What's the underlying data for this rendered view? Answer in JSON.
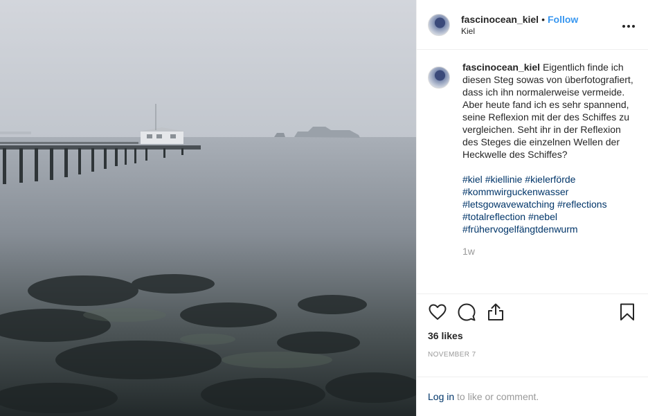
{
  "header": {
    "username": "fascinocean_kiel",
    "separator": "•",
    "follow_label": "Follow",
    "location": "Kiel",
    "more_icon": "more-horizontal-icon"
  },
  "caption": {
    "username": "fascinocean_kiel",
    "text": "Eigentlich finde ich diesen Steg sowas von überfotografiert, dass ich ihn normalerweise vermeide. Aber heute fand ich es sehr spannend, seine Reflexion mit der des Schiffes zu vergleichen. Seht ihr in der Reflexion des Steges die einzelnen Wellen der Heckwelle des Schiffes?",
    "hashtags": [
      "#kiel",
      "#kiellinie",
      "#kielerförde",
      "#kommwirguckenwasser",
      "#letsgowavewatching",
      "#reflections",
      "#totalreflection",
      "#nebel",
      "#frühervogelfängtdenwurm"
    ],
    "time": "1w"
  },
  "actions": {
    "icons": [
      "heart-icon",
      "comment-icon",
      "share-icon",
      "bookmark-icon"
    ],
    "likes": "36 likes",
    "date": "NOVEMBER 7"
  },
  "login": {
    "link_label": "Log in",
    "rest": " to like or comment."
  },
  "colors": {
    "link_blue": "#3897f0",
    "hashtag_navy": "#003569",
    "muted_gray": "#999999",
    "text": "#262626",
    "divider": "#efefef"
  }
}
